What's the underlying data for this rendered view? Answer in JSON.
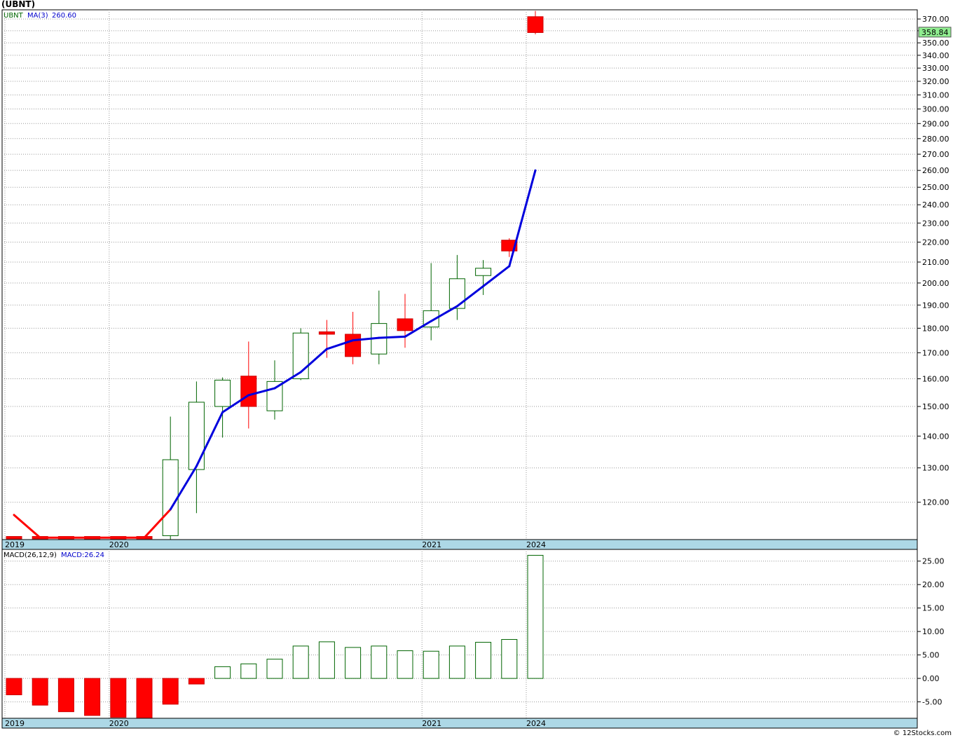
{
  "title": "(UBNT)",
  "footer": "© 12Stocks.com",
  "colors": {
    "up": "#006400",
    "down": "#ff0000",
    "ma": "#0000dd",
    "axisband": "#add8e6",
    "lastprice": "#90ee90"
  },
  "chart_data": [
    {
      "type": "candlestick",
      "legend": {
        "symbol": "UBNT",
        "ma_label": "MA(3)",
        "ma_value": "260.60"
      },
      "last_price_label": "358.84",
      "y_scale": "log",
      "ylim": [
        110,
        378
      ],
      "yticks": [
        120,
        130,
        140,
        150,
        160,
        170,
        180,
        190,
        200,
        210,
        220,
        230,
        240,
        250,
        260,
        270,
        280,
        290,
        300,
        310,
        320,
        330,
        340,
        350,
        360,
        370
      ],
      "ytick_labels": [
        "120.00",
        "130.00",
        "140.00",
        "150.00",
        "160.00",
        "170.00",
        "180.00",
        "190.00",
        "200.00",
        "210.00",
        "220.00",
        "230.00",
        "240.00",
        "250.00",
        "260.00",
        "270.00",
        "280.00",
        "290.00",
        "300.00",
        "310.00",
        "320.00",
        "330.00",
        "340.00",
        "350.00",
        "360.00",
        "370.00"
      ],
      "x_labels": [
        {
          "bar": 0,
          "text": "2019"
        },
        {
          "bar": 4,
          "text": "2020"
        },
        {
          "bar": 16,
          "text": "2021"
        },
        {
          "bar": 20,
          "text": "2024"
        }
      ],
      "candles": [
        {
          "o": 110.8,
          "h": 110.8,
          "l": 110.2,
          "c": 110.2
        },
        {
          "o": 110.8,
          "h": 110.8,
          "l": 110.2,
          "c": 110.2
        },
        {
          "o": 110.8,
          "h": 110.8,
          "l": 110.2,
          "c": 110.2
        },
        {
          "o": 110.8,
          "h": 110.8,
          "l": 110.2,
          "c": 110.2
        },
        {
          "o": 110.8,
          "h": 110.8,
          "l": 110.2,
          "c": 110.2
        },
        {
          "o": 110.8,
          "h": 110.8,
          "l": 110.2,
          "c": 110.2
        },
        {
          "o": 111.0,
          "h": 146.5,
          "l": 110.0,
          "c": 132.5
        },
        {
          "o": 129.5,
          "h": 159.0,
          "l": 117.0,
          "c": 151.5
        },
        {
          "o": 150.0,
          "h": 160.5,
          "l": 139.5,
          "c": 159.5
        },
        {
          "o": 161.0,
          "h": 174.5,
          "l": 142.5,
          "c": 150.0
        },
        {
          "o": 148.5,
          "h": 167.0,
          "l": 145.5,
          "c": 159.0
        },
        {
          "o": 160.0,
          "h": 180.0,
          "l": 159.5,
          "c": 178.0
        },
        {
          "o": 178.5,
          "h": 183.5,
          "l": 168.0,
          "c": 177.5
        },
        {
          "o": 177.5,
          "h": 187.0,
          "l": 165.5,
          "c": 168.5
        },
        {
          "o": 169.5,
          "h": 196.5,
          "l": 165.5,
          "c": 182.0
        },
        {
          "o": 184.0,
          "h": 195.0,
          "l": 172.0,
          "c": 179.0
        },
        {
          "o": 180.5,
          "h": 209.5,
          "l": 175.0,
          "c": 187.5
        },
        {
          "o": 188.5,
          "h": 213.5,
          "l": 183.5,
          "c": 202.0
        },
        {
          "o": 203.5,
          "h": 211.0,
          "l": 194.5,
          "c": 207.0
        },
        {
          "o": 221.0,
          "h": 222.0,
          "l": 212.5,
          "c": 215.5
        },
        {
          "o": 372.0,
          "h": 377.0,
          "l": 357.0,
          "c": 358.5
        }
      ],
      "ma_values": [
        116.5,
        110.5,
        110.5,
        110.5,
        110.5,
        110.5,
        118.0,
        130.5,
        148.0,
        154.0,
        156.5,
        162.5,
        171.5,
        175.0,
        176.0,
        176.5,
        183.0,
        189.5,
        198.5,
        208.0,
        260.0
      ],
      "ma_colors": [
        "down",
        "down",
        "down",
        "down",
        "down",
        "down",
        "ma",
        "ma",
        "ma",
        "ma",
        "ma",
        "ma",
        "ma",
        "ma",
        "ma",
        "ma",
        "ma",
        "ma",
        "ma",
        "ma",
        "ma"
      ]
    },
    {
      "type": "bar",
      "legend": {
        "label": "MACD(26,12,9)",
        "value_label": "MACD:26.24"
      },
      "ylim": [
        -8.5,
        27.5
      ],
      "yticks": [
        -5,
        0,
        5,
        10,
        15,
        20,
        25
      ],
      "ytick_labels": [
        "-5.00",
        "0.00",
        "5.00",
        "10.00",
        "15.00",
        "20.00",
        "25.00"
      ],
      "values": [
        -3.5,
        -5.7,
        -7.1,
        -7.9,
        -8.3,
        -8.5,
        -5.5,
        -1.2,
        2.5,
        3.1,
        4.1,
        6.9,
        7.8,
        6.6,
        6.9,
        5.9,
        5.8,
        6.9,
        7.7,
        8.3,
        26.24
      ]
    }
  ]
}
